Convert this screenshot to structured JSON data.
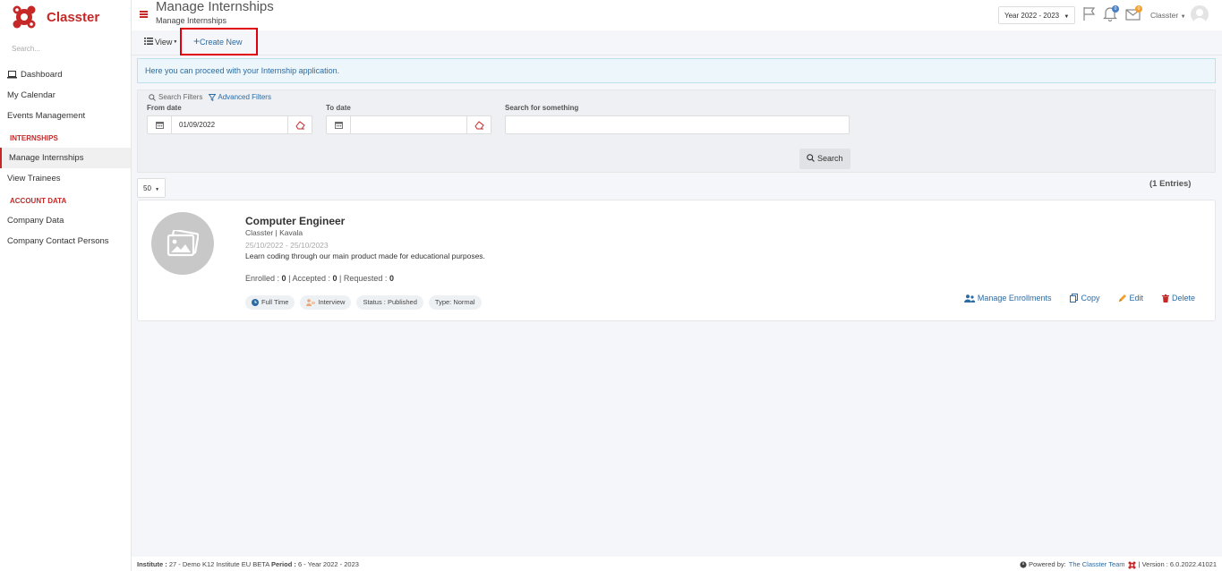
{
  "app": {
    "name": "Classter"
  },
  "sidebar": {
    "search_placeholder": "Search...",
    "items": [
      {
        "label": "Dashboard",
        "icon": "laptop-icon"
      },
      {
        "label": "My Calendar"
      },
      {
        "label": "Events Management"
      }
    ],
    "section_internships": "INTERNSHIPS",
    "internship_items": [
      {
        "label": "Manage Internships",
        "active": true
      },
      {
        "label": "View Trainees"
      }
    ],
    "section_account": "ACCOUNT DATA",
    "account_items": [
      {
        "label": "Company Data"
      },
      {
        "label": "Company Contact Persons"
      }
    ]
  },
  "header": {
    "title": "Manage Internships",
    "breadcrumb": "Manage Internships",
    "year_select": "Year 2022 - 2023",
    "notifications_badge": "0",
    "messages_badge": "0",
    "user_name": "Classter"
  },
  "toolbar": {
    "view_label": "View",
    "create_label": "Create New"
  },
  "info_message": "Here you can proceed with your Internship application.",
  "filters": {
    "tab_search": "Search Filters",
    "tab_advanced": "Advanced Filters",
    "from_date_label": "From date",
    "from_date_value": "01/09/2022",
    "to_date_label": "To date",
    "to_date_value": "",
    "search_label": "Search for something",
    "search_value": "",
    "search_button": "Search"
  },
  "results": {
    "page_size": "50",
    "entries": "(1 Entries)"
  },
  "internship": {
    "title": "Computer Engineer",
    "organization": "Classter | Kavala",
    "dates": "25/10/2022 - 25/10/2023",
    "description": "Learn coding through our main product made for educational purposes.",
    "enrolled_label": "Enrolled :",
    "enrolled": "0",
    "accepted_label": "Accepted :",
    "accepted": "0",
    "requested_label": "Requested :",
    "requested": "0",
    "tags": [
      "Full Time",
      "Interview",
      "Status : Published",
      "Type: Normal"
    ],
    "actions": {
      "manage": "Manage Enrollments",
      "copy": "Copy",
      "edit": "Edit",
      "delete": "Delete"
    }
  },
  "footer": {
    "institute_label": "Institute :",
    "institute_value": "27 - Demo K12 Institute EU BETA",
    "period_label": "Period :",
    "period_value": "6 - Year 2022 - 2023",
    "powered_by": "Powered by:",
    "team": "The Classter Team",
    "version": "| Version : 6.0.2022.41021"
  },
  "colors": {
    "brand": "#c62828",
    "link": "#2b6aa3",
    "highlight_border": "#e0000d"
  }
}
